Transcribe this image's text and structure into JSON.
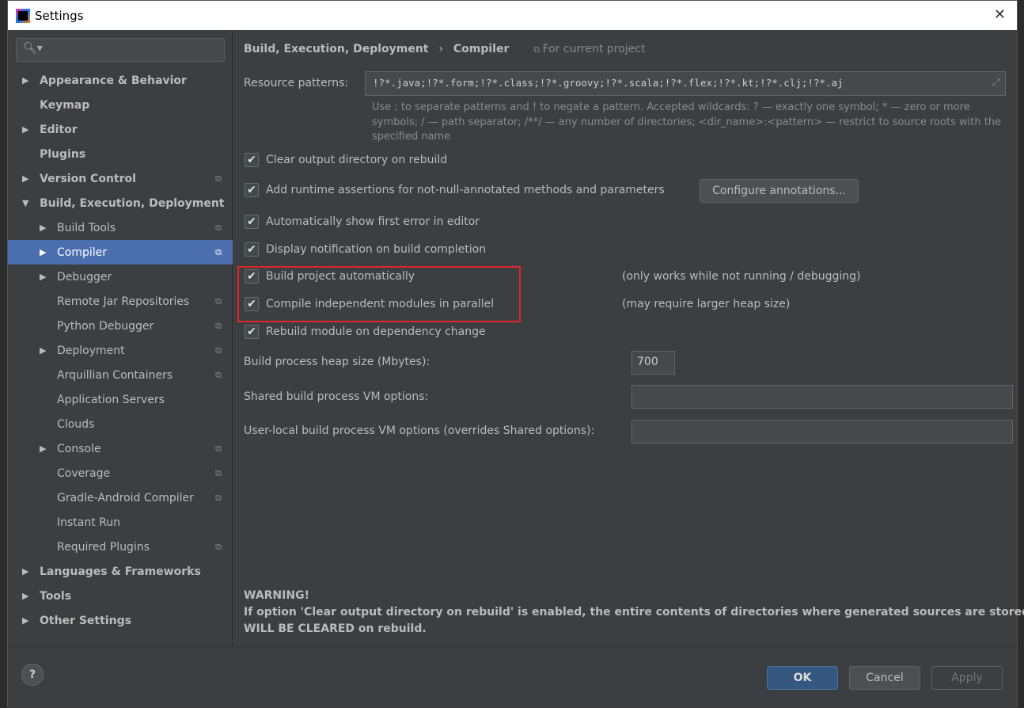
{
  "window": {
    "title": "Settings",
    "close": "✕"
  },
  "sidebar": {
    "search_placeholder": "",
    "items": [
      {
        "label": "Appearance & Behavior",
        "arrow": "▶",
        "bold": true,
        "level": 0
      },
      {
        "label": "Keymap",
        "arrow": "",
        "bold": true,
        "level": 0
      },
      {
        "label": "Editor",
        "arrow": "▶",
        "bold": true,
        "level": 0
      },
      {
        "label": "Plugins",
        "arrow": "",
        "bold": true,
        "level": 0
      },
      {
        "label": "Version Control",
        "arrow": "▶",
        "bold": true,
        "level": 0,
        "copy": true
      },
      {
        "label": "Build, Execution, Deployment",
        "arrow": "▼",
        "bold": true,
        "level": 0
      },
      {
        "label": "Build Tools",
        "arrow": "▶",
        "level": 1,
        "copy": true
      },
      {
        "label": "Compiler",
        "arrow": "▶",
        "level": 1,
        "copy": true,
        "selected": true
      },
      {
        "label": "Debugger",
        "arrow": "▶",
        "level": 1
      },
      {
        "label": "Remote Jar Repositories",
        "arrow": "",
        "level": 1,
        "copy": true
      },
      {
        "label": "Python Debugger",
        "arrow": "",
        "level": 1,
        "copy": true
      },
      {
        "label": "Deployment",
        "arrow": "▶",
        "level": 1,
        "copy": true
      },
      {
        "label": "Arquillian Containers",
        "arrow": "",
        "level": 1,
        "copy": true
      },
      {
        "label": "Application Servers",
        "arrow": "",
        "level": 1
      },
      {
        "label": "Clouds",
        "arrow": "",
        "level": 1
      },
      {
        "label": "Console",
        "arrow": "▶",
        "level": 1,
        "copy": true
      },
      {
        "label": "Coverage",
        "arrow": "",
        "level": 1,
        "copy": true
      },
      {
        "label": "Gradle-Android Compiler",
        "arrow": "",
        "level": 1,
        "copy": true
      },
      {
        "label": "Instant Run",
        "arrow": "",
        "level": 1
      },
      {
        "label": "Required Plugins",
        "arrow": "",
        "level": 1,
        "copy": true
      },
      {
        "label": "Languages & Frameworks",
        "arrow": "▶",
        "bold": true,
        "level": 0
      },
      {
        "label": "Tools",
        "arrow": "▶",
        "bold": true,
        "level": 0
      },
      {
        "label": "Other Settings",
        "arrow": "▶",
        "bold": true,
        "level": 0
      }
    ]
  },
  "breadcrumb": {
    "parent": "Build, Execution, Deployment",
    "sep": "›",
    "current": "Compiler",
    "scope": "For current project"
  },
  "resource": {
    "label": "Resource patterns:",
    "value": "!?*.java;!?*.form;!?*.class;!?*.groovy;!?*.scala;!?*.flex;!?*.kt;!?*.clj;!?*.aj",
    "hint": "Use ; to separate patterns and ! to negate a pattern. Accepted wildcards: ? — exactly one symbol; * — zero or more symbols; / — path separator; /**/ — any number of directories; <dir_name>:<pattern> — restrict to source roots with the specified name"
  },
  "options": [
    {
      "label": "Clear output directory on rebuild",
      "checked": true
    },
    {
      "label": "Add runtime assertions for not-null-annotated methods and parameters",
      "checked": true
    },
    {
      "label": "Automatically show first error in editor",
      "checked": true
    },
    {
      "label": "Display notification on build completion",
      "checked": true
    },
    {
      "label": "Build project automatically",
      "checked": true,
      "note": "(only works while not running / debugging)"
    },
    {
      "label": "Compile independent modules in parallel",
      "checked": true,
      "note": "(may require larger heap size)"
    },
    {
      "label": "Rebuild module on dependency change",
      "checked": true
    }
  ],
  "configure_button": "Configure annotations...",
  "heap": {
    "label": "Build process heap size (Mbytes):",
    "value": "700"
  },
  "shared_vm": {
    "label": "Shared build process VM options:",
    "value": ""
  },
  "local_vm": {
    "label": "User-local build process VM options (overrides Shared options):",
    "value": ""
  },
  "warning": {
    "title": "WARNING!",
    "line1": "If option 'Clear output directory on rebuild' is enabled, the entire contents of directories where generated sources are stored",
    "line2": "WILL BE CLEARED on rebuild."
  },
  "footer": {
    "help": "?",
    "ok": "OK",
    "cancel": "Cancel",
    "apply": "Apply"
  },
  "colors": {
    "highlight": "#e0252b",
    "selection": "#4b6eaf",
    "ok": "#365880"
  }
}
